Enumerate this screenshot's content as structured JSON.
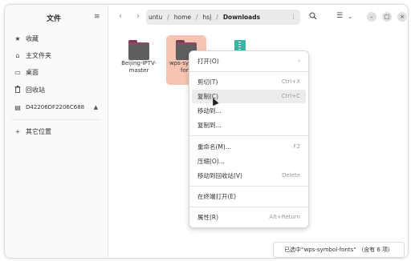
{
  "sidebar": {
    "title": "文件",
    "menu_icon": "≡",
    "items": [
      {
        "icon": "star-icon",
        "glyph": "★",
        "label": "收藏"
      },
      {
        "icon": "home-icon",
        "glyph": "⌂",
        "label": "主文件夹"
      },
      {
        "icon": "desktop-icon",
        "glyph": "▭",
        "label": "桌面"
      },
      {
        "icon": "trash-icon",
        "glyph": "🗑",
        "label": "回收站"
      },
      {
        "icon": "drive-icon",
        "glyph": "▤",
        "label": "D42206DF2206C688",
        "eject": "▲"
      },
      {
        "icon": "plus-icon",
        "glyph": "+",
        "label": "其它位置"
      }
    ]
  },
  "header": {
    "back": "‹",
    "forward": "›",
    "breadcrumbs": [
      "untu",
      "home",
      "hsj",
      "Downloads"
    ],
    "separator": "/",
    "path_menu": "⋮",
    "search_icon": "⚲",
    "view_list": "☰",
    "view_dropdown": "⌄",
    "minimize": "–",
    "maximize": "□",
    "close": "×"
  },
  "files": [
    {
      "name": "Beijing-IPTV-master",
      "line1": "Beijing-IPTV-",
      "line2": "master",
      "type": "folder"
    },
    {
      "name": "wps-symbol-fonts",
      "line1": "wps-sy",
      "line2": "fon",
      "type": "folder",
      "selected": true
    },
    {
      "name": "archive",
      "type": "archive"
    }
  ],
  "context_menu": {
    "items": [
      {
        "label": "打开(O)",
        "accel": "›"
      },
      {
        "label": "剪切(T)",
        "accel": "Ctrl+X"
      },
      {
        "label": "复制(C)",
        "accel": "Ctrl+C",
        "hover": true
      },
      {
        "label": "移动到...",
        "accel": ""
      },
      {
        "label": "复制到...",
        "accel": ""
      },
      {
        "label": "重命名(M)...",
        "accel": "F2"
      },
      {
        "label": "压缩(O)...",
        "accel": ""
      },
      {
        "label": "移动到回收站(V)",
        "accel": "Delete"
      },
      {
        "label": "在终端打开(E)",
        "accel": ""
      },
      {
        "label": "属性(R)",
        "accel": "Alt+Return"
      }
    ]
  },
  "status": "已选中“wps-symbol-fonts” （含有 6 项）",
  "colors": {
    "selection": "#f5c4b2",
    "folder_body": "#5e5e5e",
    "folder_tab": "#7a3d55",
    "archive": "#3bb3a6"
  }
}
